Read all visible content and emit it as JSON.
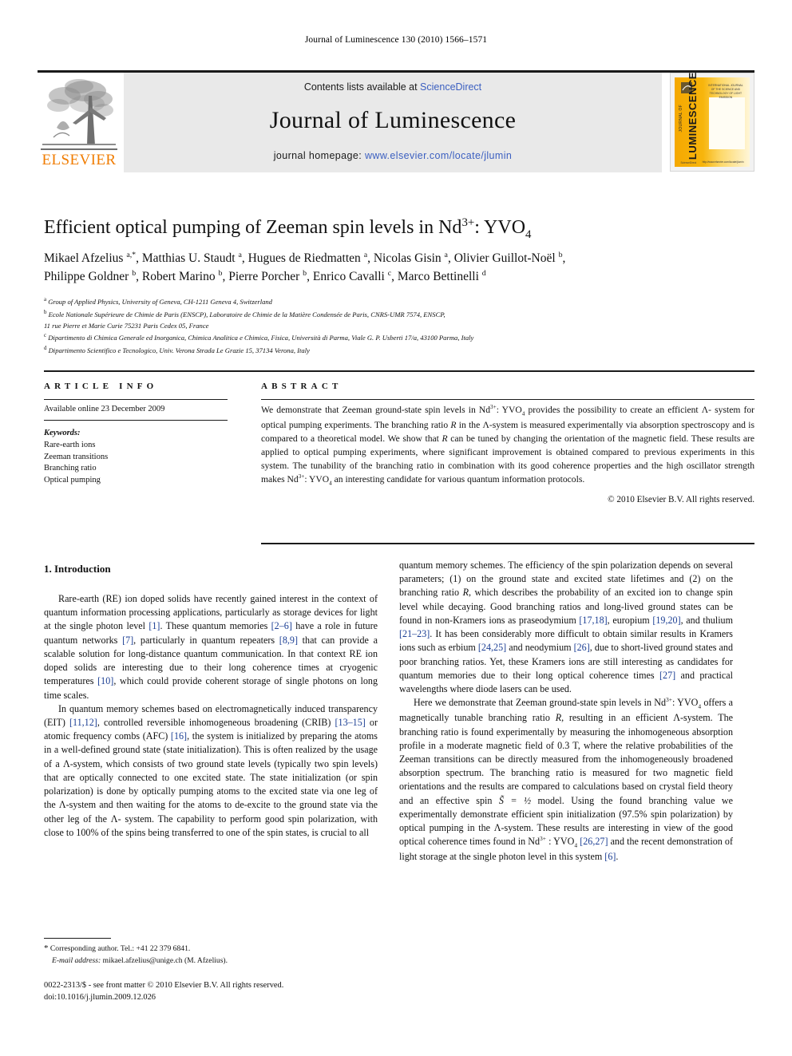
{
  "running_head": "Journal of Luminescence 130 (2010) 1566–1571",
  "masthead": {
    "contents_prefix": "Contents lists available at ",
    "sciencedirect": "ScienceDirect",
    "journal_title": "Journal of Luminescence",
    "homepage_prefix": "journal homepage: ",
    "homepage_url": "www.elsevier.com/locate/jlumin",
    "elsevier_wordmark": "ELSEVIER",
    "sciencedirect_color": "#3b5fc0",
    "elsevier_orange": "#f07c00"
  },
  "cover": {
    "vertical_title": "LUMINESCENCE",
    "vertical_sub": "JOURNAL OF",
    "top_lines": "INTERNATIONAL JOURNAL OF THE SCIENCE\nAND TECHNOLOGY OF LIGHT EMISSION",
    "foot_left": "ScienceDirect",
    "foot_right": "http://www.elsevier.com/locate/jlumin"
  },
  "article": {
    "title_part1": "Efficient optical pumping of Zeeman spin levels in Nd",
    "title_sup": "3+",
    "title_part2": ": YVO",
    "title_sub": "4",
    "authors_line1": "Mikael Afzelius a,*, Matthias U. Staudt a, Hugues de Riedmatten a, Nicolas Gisin a, Olivier Guillot-Noël b,",
    "authors_line2": "Philippe Goldner b, Robert Marino b, Pierre Porcher b, Enrico Cavalli c, Marco Bettinelli d",
    "affiliations": [
      {
        "marker": "a",
        "text": "Group of Applied Physics, University of Geneva, CH-1211 Geneva 4, Switzerland"
      },
      {
        "marker": "b",
        "text": "Ecole Nationale Supérieure de Chimie de Paris (ENSCP), Laboratoire de Chimie de la Matière Condensée de Paris, CNRS-UMR 7574, ENSCP,"
      },
      {
        "marker": "",
        "text": "11 rue Pierre et Marie Curie 75231 Paris Cedex 05, France"
      },
      {
        "marker": "c",
        "text": "Dipartimento di Chimica Generale ed Inorganica, Chimica Analitica e Chimica, Fisica, Università di Parma, Viale G. P. Usberti 17/a, 43100 Parma, Italy"
      },
      {
        "marker": "d",
        "text": "Dipartimento Scientifico e Tecnologico, Univ. Verona Strada Le Grazie 15, 37134 Verona, Italy"
      }
    ]
  },
  "article_info": {
    "section_label": "ARTICLE INFO",
    "available_online": "Available online 23 December 2009",
    "keywords_heading": "Keywords:",
    "keywords": [
      "Rare-earth ions",
      "Zeeman transitions",
      "Branching ratio",
      "Optical pumping"
    ]
  },
  "abstract": {
    "section_label": "ABSTRACT",
    "text_1": "We demonstrate that Zeeman ground-state spin levels in Nd",
    "sup_1": "3+",
    "text_2": ": YVO",
    "sub_1": "4",
    "text_3": " provides the possibility to create an efficient Λ- system for optical pumping experiments. The branching ratio ",
    "italic_R1": "R",
    "text_4": " in the Λ-system is measured experimentally via absorption spectroscopy and is compared to a theoretical model. We show that ",
    "italic_R2": "R",
    "text_5": " can be tuned by changing the orientation of the magnetic field. These results are applied to optical pumping experiments, where significant improvement is obtained compared to previous experiments in this system. The tunability of the branching ratio in combination with its good coherence properties and the high oscillator strength makes Nd",
    "sup_2": "3+",
    "text_6": ": YVO",
    "sub_2": "4",
    "text_7": " an interesting candidate for various quantum information protocols.",
    "copyright": "© 2010 Elsevier B.V. All rights reserved."
  },
  "body": {
    "section_number_title": "1.  Introduction",
    "left_p1_a": "Rare-earth (RE) ion doped solids have recently gained interest in the context of quantum information processing applications, particularly as storage devices for light at the single photon level ",
    "left_p1_r1": "[1]",
    "left_p1_b": ". These quantum memories ",
    "left_p1_r2": "[2–6]",
    "left_p1_c": " have a role in future quantum networks ",
    "left_p1_r3": "[7]",
    "left_p1_d": ", particularly in quantum repeaters ",
    "left_p1_r4": "[8,9]",
    "left_p1_e": " that can provide a scalable solution for long-distance quantum communication. In that context RE ion doped solids are interesting due to their long coherence times at cryogenic temperatures ",
    "left_p1_r5": "[10]",
    "left_p1_f": ", which could provide coherent storage of single photons on long time scales.",
    "left_p2_a": "In quantum memory schemes based on electromagnetically induced transparency (EIT) ",
    "left_p2_r1": "[11,12]",
    "left_p2_b": ", controlled reversible inhomogeneous broadening (CRIB) ",
    "left_p2_r2": "[13–15]",
    "left_p2_c": " or atomic frequency combs (AFC) ",
    "left_p2_r3": "[16]",
    "left_p2_d": ", the system is initialized by preparing the atoms in a well-defined ground state (state initialization). This is often realized by the usage of a Λ-system, which consists of two ground state levels (typically two spin levels) that are optically connected to one excited state. The state initialization (or spin polarization) is done by optically pumping atoms to the excited state via one leg of the Λ-system and then waiting for the atoms to de-excite to the ground state via the other leg of the Λ- system. The capability to perform good spin polarization, with close to 100% of the spins being transferred to one of the spin states, is crucial to all",
    "right_p1_a": "quantum memory schemes. The efficiency of the spin polarization depends on several parameters; (1) on the ground state and excited state lifetimes and (2) on the branching ratio ",
    "right_p1_R": "R",
    "right_p1_b": ", which describes the probability of an excited ion to change spin level while decaying. Good branching ratios and long-lived ground states can be found in non-Kramers ions as praseodymium ",
    "right_p1_r1": "[17,18]",
    "right_p1_c": ", europium ",
    "right_p1_r2": "[19,20]",
    "right_p1_d": ", and thulium ",
    "right_p1_r3": "[21–23]",
    "right_p1_e": ". It has been considerably more difficult to obtain similar results in Kramers ions such as erbium ",
    "right_p1_r4": "[24,25]",
    "right_p1_f": " and neodymium ",
    "right_p1_r5": "[26]",
    "right_p1_g": ", due to short-lived ground states and poor branching ratios. Yet, these Kramers ions are still interesting as candidates for quantum memories due to their long optical coherence times ",
    "right_p1_r6": "[27]",
    "right_p1_h": " and practical wavelengths where diode lasers can be used.",
    "right_p2_a": "Here we demonstrate that Zeeman ground-state spin levels in Nd",
    "right_p2_sup1": "3+",
    "right_p2_b": ": YVO",
    "right_p2_sub1": "4",
    "right_p2_c": " offers a magnetically tunable branching ratio ",
    "right_p2_R": "R",
    "right_p2_d": ", resulting in an efficient Λ-system. The branching ratio is found experimentally by measuring the inhomogeneous absorption profile in a moderate magnetic field of 0.3 T, where the relative probabilities of the Zeeman transitions can be directly measured from the inhomogeneously broadened absorption spectrum. The branching ratio is measured for two magnetic field orientations and the results are compared to calculations based on crystal field theory and an effective spin ",
    "right_p2_spin": "S̃ = ½",
    "right_p2_e": " model. Using the found branching value we experimentally demonstrate efficient spin initialization (97.5% spin polarization) by optical pumping in the Λ-system. These results are interesting in view of the good optical coherence times found in Nd",
    "right_p2_sup2": "3+",
    "right_p2_f": " : YVO",
    "right_p2_sub2": "4",
    "right_p2_g": " ",
    "right_p2_r1": "[26,27]",
    "right_p2_h": " and the recent demonstration of light storage at the single photon level in this system ",
    "right_p2_r2": "[6]",
    "right_p2_i": ".",
    "reference_color": "#1c3f94"
  },
  "footnote": {
    "star": "*",
    "corresponding": " Corresponding author. Tel.: +41 22 379 6841.",
    "email_label": "E-mail address:",
    "email": " mikael.afzelius@unige.ch (M. Afzelius)."
  },
  "footer": {
    "line1": "0022-2313/$ - see front matter © 2010 Elsevier B.V. All rights reserved.",
    "line2": "doi:10.1016/j.jlumin.2009.12.026"
  }
}
